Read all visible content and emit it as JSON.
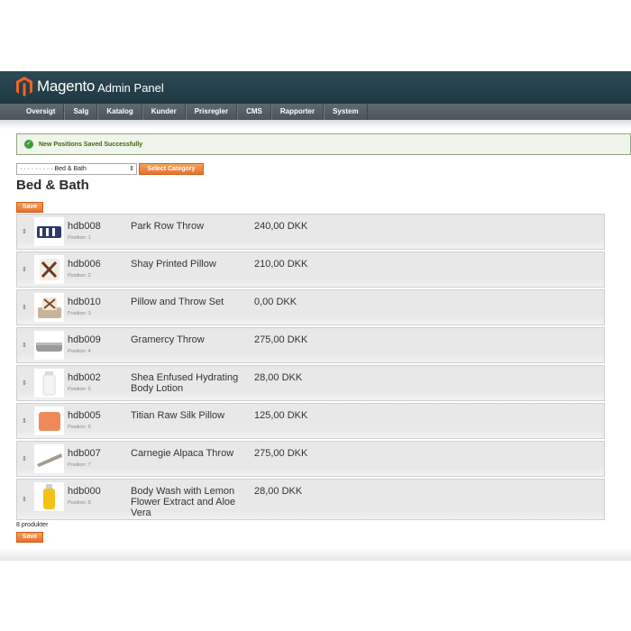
{
  "header": {
    "brand": "Magento",
    "subtitle": "Admin Panel"
  },
  "nav": [
    "Oversigt",
    "Salg",
    "Katalog",
    "Kunder",
    "Prisregler",
    "CMS",
    "Rapporter",
    "System"
  ],
  "message": {
    "text": "New Positions Saved Successfully",
    "icon": "check-circle-icon"
  },
  "category_select": {
    "value": "· · · · · · · · · Bed & Bath",
    "arrows": "⇕"
  },
  "select_category_label": "Select Category",
  "page_title": "Bed & Bath",
  "save_label": "Save",
  "products": [
    {
      "sku": "hdb008",
      "position": "Position: 1",
      "name": "Park Row Throw",
      "price": "240,00 DKK",
      "thumb": "navy-throw"
    },
    {
      "sku": "hdb006",
      "position": "Position: 2",
      "name": "Shay Printed Pillow",
      "price": "210,00 DKK",
      "thumb": "printed-pillow"
    },
    {
      "sku": "hdb010",
      "position": "Position: 3",
      "name": "Pillow and Throw Set",
      "price": "0,00 DKK",
      "thumb": "pillow-throw-set"
    },
    {
      "sku": "hdb009",
      "position": "Position: 4",
      "name": "Gramercy Throw",
      "price": "275,00 DKK",
      "thumb": "grey-throw"
    },
    {
      "sku": "hdb002",
      "position": "Position: 5",
      "name": "Shea Enfused Hydrating Body Lotion",
      "price": "28,00 DKK",
      "thumb": "lotion-bottle"
    },
    {
      "sku": "hdb005",
      "position": "Position: 6",
      "name": "Titian Raw Silk Pillow",
      "price": "125,00 DKK",
      "thumb": "orange-pillow"
    },
    {
      "sku": "hdb007",
      "position": "Position: 7",
      "name": "Carnegie Alpaca Throw",
      "price": "275,00 DKK",
      "thumb": "alpaca-throw"
    },
    {
      "sku": "hdb000",
      "position": "Position: 8",
      "name": "Body Wash with Lemon Flower Extract and Aloe Vera",
      "price": "28,00 DKK",
      "thumb": "body-wash-bottle"
    }
  ],
  "count_text": "8 produkter",
  "colors": {
    "accent": "#eb7a33",
    "header": "#23404a",
    "success": "#3d6611"
  }
}
